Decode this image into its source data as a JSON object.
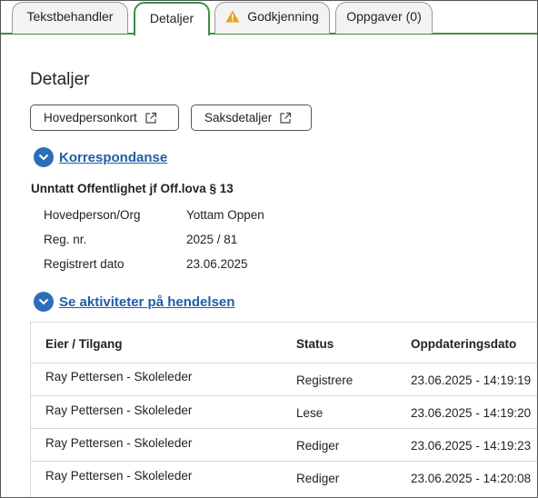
{
  "tabs": [
    {
      "label": "Tekstbehandler",
      "active": false
    },
    {
      "label": "Detaljer",
      "active": true
    },
    {
      "label": "Godkjenning",
      "active": false,
      "icon": "warning-icon"
    },
    {
      "label": "Oppgaver (0)",
      "active": false
    }
  ],
  "page": {
    "title": "Detaljer",
    "buttons": {
      "main_person_card": "Hovedpersonkort",
      "case_details": "Saksdetaljer"
    }
  },
  "correspondence": {
    "toggle_label": "Korrespondanse",
    "subtitle": "Unntatt Offentlighet jf Off.lova § 13",
    "fields": [
      {
        "label": "Hovedperson/Org",
        "value": "Yottam Oppen"
      },
      {
        "label": "Reg. nr.",
        "value": "2025 / 81"
      },
      {
        "label": "Registrert dato",
        "value": "23.06.2025"
      }
    ]
  },
  "activities": {
    "toggle_label": "Se aktiviteter på hendelsen",
    "columns": [
      "Eier / Tilgang",
      "Status",
      "Oppdateringsdato"
    ],
    "rows": [
      {
        "owner": "Ray Pettersen - Skoleleder",
        "status": "Registrere",
        "date": "23.06.2025 - 14:19:19"
      },
      {
        "owner": "Ray Pettersen - Skoleleder",
        "status": "Lese",
        "date": "23.06.2025 - 14:19:20"
      },
      {
        "owner": "Ray Pettersen - Skoleleder",
        "status": "Rediger",
        "date": "23.06.2025 - 14:19:23"
      },
      {
        "owner": "Ray Pettersen - Skoleleder",
        "status": "Rediger",
        "date": "23.06.2025 - 14:20:08"
      }
    ]
  },
  "colors": {
    "active_tab_border": "#3f8f3f",
    "link": "#1f5ea8",
    "chevron_bg": "#2a6ebb",
    "warning": "#e8a317"
  }
}
